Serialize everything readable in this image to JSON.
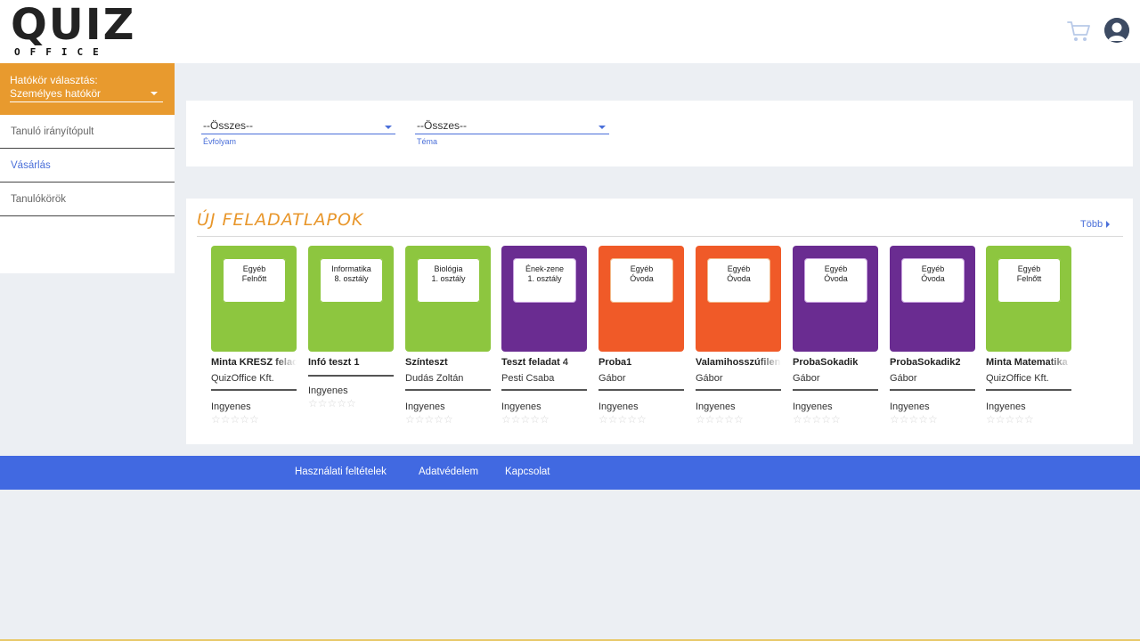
{
  "header": {
    "logo_top": "QUIZ",
    "logo_bottom": "OFFICE",
    "cart_icon": "shopping-cart-icon",
    "avatar_icon": "user-avatar-icon"
  },
  "sidebar": {
    "scope_label": "Hatókör választás:",
    "scope_value": "Személyes hatókör",
    "items": [
      {
        "label": "Tanuló irányítópult"
      },
      {
        "label": "Vásárlás"
      },
      {
        "label": "Tanulókörök"
      }
    ]
  },
  "filters": {
    "grade": {
      "value": "--Összes--",
      "label": "Évfolyam"
    },
    "topic": {
      "value": "--Összes--",
      "label": "Téma"
    }
  },
  "new_sheets": {
    "title": "ÚJ FELADATLAPOK",
    "more_label": "Több",
    "cards": [
      {
        "line1": "Egyéb",
        "line2": "Felnőtt",
        "title": "Minta KRESZ feladatlap",
        "author": "QuizOffice Kft.",
        "price": "Ingyenes",
        "color": "#8dc63f",
        "stars": "☆☆☆☆☆"
      },
      {
        "line1": "Informatika",
        "line2": "8. osztály",
        "title": "Infó teszt 1",
        "author": "",
        "price": "Ingyenes",
        "color": "#8dc63f",
        "stars": "☆☆☆☆☆"
      },
      {
        "line1": "Biológia",
        "line2": "1. osztály",
        "title": "Színteszt",
        "author": "Dudás Zoltán",
        "price": "Ingyenes",
        "color": "#8dc63f",
        "stars": "☆☆☆☆☆"
      },
      {
        "line1": "Ének-zene",
        "line2": "1. osztály",
        "title": "Teszt feladat 4",
        "author": "Pesti Csaba",
        "price": "Ingyenes",
        "color": "#6a2c91",
        "stars": "☆☆☆☆☆"
      },
      {
        "line1": "Egyéb",
        "line2": "Óvoda",
        "title": "Proba1",
        "author": "Gábor",
        "price": "Ingyenes",
        "color": "#f05a28",
        "stars": "☆☆☆☆☆"
      },
      {
        "line1": "Egyéb",
        "line2": "Óvoda",
        "title": "Valamihosszúfilenév",
        "author": "Gábor",
        "price": "Ingyenes",
        "color": "#f05a28",
        "stars": "☆☆☆☆☆"
      },
      {
        "line1": "Egyéb",
        "line2": "Óvoda",
        "title": "ProbaSokadik",
        "author": "Gábor",
        "price": "Ingyenes",
        "color": "#6a2c91",
        "stars": "☆☆☆☆☆"
      },
      {
        "line1": "Egyéb",
        "line2": "Óvoda",
        "title": "ProbaSokadik2",
        "author": "Gábor",
        "price": "Ingyenes",
        "color": "#6a2c91",
        "stars": "☆☆☆☆☆"
      },
      {
        "line1": "Egyéb",
        "line2": "Felnőtt",
        "title": "Minta Matematika",
        "author": "QuizOffice Kft.",
        "price": "Ingyenes",
        "color": "#8dc63f",
        "stars": "☆☆☆☆☆"
      }
    ]
  },
  "footer": {
    "links": [
      {
        "label": "Használati feltételek"
      },
      {
        "label": "Adatvédelem"
      },
      {
        "label": "Kapcsolat"
      }
    ]
  }
}
